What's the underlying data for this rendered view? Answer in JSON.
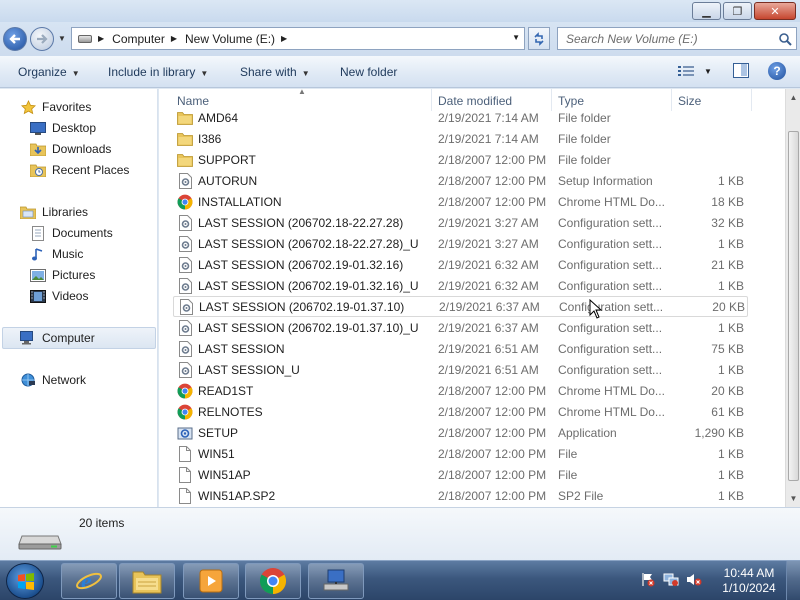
{
  "window": {
    "minimize_glyph": "▁",
    "restore_glyph": "❐",
    "close_glyph": "✕"
  },
  "address": {
    "crumbs": [
      "Computer",
      "New Volume (E:)"
    ],
    "search_placeholder": "Search New Volume (E:)"
  },
  "toolbar": {
    "organize": "Organize",
    "include_in_library": "Include in library",
    "share_with": "Share with",
    "new_folder": "New folder"
  },
  "nav": {
    "favorites": "Favorites",
    "desktop": "Desktop",
    "downloads": "Downloads",
    "recent_places": "Recent Places",
    "libraries": "Libraries",
    "documents": "Documents",
    "music": "Music",
    "pictures": "Pictures",
    "videos": "Videos",
    "computer": "Computer",
    "network": "Network"
  },
  "columns": {
    "name": "Name",
    "date_modified": "Date modified",
    "type": "Type",
    "size": "Size"
  },
  "files": [
    {
      "name": "AMD64",
      "date": "2/19/2021 7:14 AM",
      "type": "File folder",
      "size": "",
      "icon": "folder-icon"
    },
    {
      "name": "I386",
      "date": "2/19/2021 7:14 AM",
      "type": "File folder",
      "size": "",
      "icon": "folder-icon"
    },
    {
      "name": "SUPPORT",
      "date": "2/18/2007 12:00 PM",
      "type": "File folder",
      "size": "",
      "icon": "folder-icon"
    },
    {
      "name": "AUTORUN",
      "date": "2/18/2007 12:00 PM",
      "type": "Setup Information",
      "size": "1 KB",
      "icon": "config-file-icon"
    },
    {
      "name": "INSTALLATION",
      "date": "2/18/2007 12:00 PM",
      "type": "Chrome HTML Do...",
      "size": "18 KB",
      "icon": "chrome-icon"
    },
    {
      "name": "LAST SESSION (206702.18-22.27.28)",
      "date": "2/19/2021 3:27 AM",
      "type": "Configuration sett...",
      "size": "32 KB",
      "icon": "config-file-icon"
    },
    {
      "name": "LAST SESSION (206702.18-22.27.28)_U",
      "date": "2/19/2021 3:27 AM",
      "type": "Configuration sett...",
      "size": "1 KB",
      "icon": "config-file-icon"
    },
    {
      "name": "LAST SESSION (206702.19-01.32.16)",
      "date": "2/19/2021 6:32 AM",
      "type": "Configuration sett...",
      "size": "21 KB",
      "icon": "config-file-icon"
    },
    {
      "name": "LAST SESSION (206702.19-01.32.16)_U",
      "date": "2/19/2021 6:32 AM",
      "type": "Configuration sett...",
      "size": "1 KB",
      "icon": "config-file-icon"
    },
    {
      "name": "LAST SESSION (206702.19-01.37.10)",
      "date": "2/19/2021 6:37 AM",
      "type": "Configuration sett...",
      "size": "20 KB",
      "icon": "config-file-icon"
    },
    {
      "name": "LAST SESSION (206702.19-01.37.10)_U",
      "date": "2/19/2021 6:37 AM",
      "type": "Configuration sett...",
      "size": "1 KB",
      "icon": "config-file-icon"
    },
    {
      "name": "LAST SESSION",
      "date": "2/19/2021 6:51 AM",
      "type": "Configuration sett...",
      "size": "75 KB",
      "icon": "config-file-icon"
    },
    {
      "name": "LAST SESSION_U",
      "date": "2/19/2021 6:51 AM",
      "type": "Configuration sett...",
      "size": "1 KB",
      "icon": "config-file-icon"
    },
    {
      "name": "READ1ST",
      "date": "2/18/2007 12:00 PM",
      "type": "Chrome HTML Do...",
      "size": "20 KB",
      "icon": "chrome-icon"
    },
    {
      "name": "RELNOTES",
      "date": "2/18/2007 12:00 PM",
      "type": "Chrome HTML Do...",
      "size": "61 KB",
      "icon": "chrome-icon"
    },
    {
      "name": "SETUP",
      "date": "2/18/2007 12:00 PM",
      "type": "Application",
      "size": "1,290 KB",
      "icon": "setup-app-icon"
    },
    {
      "name": "WIN51",
      "date": "2/18/2007 12:00 PM",
      "type": "File",
      "size": "1 KB",
      "icon": "blank-file-icon"
    },
    {
      "name": "WIN51AP",
      "date": "2/18/2007 12:00 PM",
      "type": "File",
      "size": "1 KB",
      "icon": "blank-file-icon"
    },
    {
      "name": "WIN51AP.SP2",
      "date": "2/18/2007 12:00 PM",
      "type": "SP2 File",
      "size": "1 KB",
      "icon": "blank-file-icon"
    }
  ],
  "details": {
    "item_count": "20 items"
  },
  "taskbar": {
    "time": "10:44 AM",
    "date": "1/10/2024"
  },
  "colors": {
    "folder": "#e8c45a",
    "accent_blue": "#1f4f9c",
    "taskbar": "#3b577d"
  }
}
